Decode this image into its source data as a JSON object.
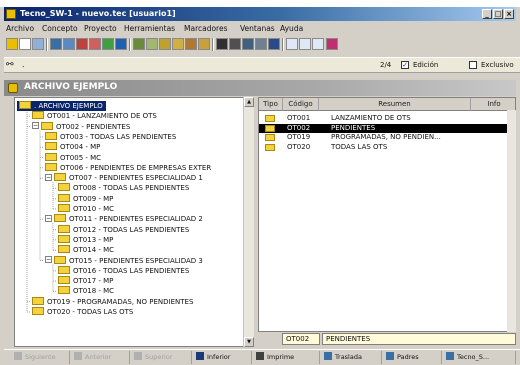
{
  "window": {
    "title": "Tecno_SW-1 - nuevo.tec  [usuario1]",
    "top_fringe_text": "..."
  },
  "menu": [
    "Archivo",
    "Concepto",
    "Proyecto",
    "Herramientas",
    "Marcadores",
    "Ventanas",
    "Ayuda"
  ],
  "nav": {
    "page_indicator": "2/4",
    "edit_checkbox_label": "Edición",
    "edit_checked": true,
    "exclusive_checkbox_label": "Exclusivo",
    "exclusive_checked": false
  },
  "header": {
    "title": "ARCHIVO EJEMPLO"
  },
  "tree": [
    {
      "label": ". ARCHIVO EJEMPLO",
      "level": 0,
      "selected": true
    },
    {
      "label": "OT001 - LANZAMIENTO DE OTS",
      "level": 1
    },
    {
      "label": "OT002 - PENDIENTES",
      "level": 1,
      "expanded": true
    },
    {
      "label": "OT003 - TODAS LAS PENDIENTES",
      "level": 2
    },
    {
      "label": "OT004 - MP",
      "level": 2
    },
    {
      "label": "OT005 - MC",
      "level": 2
    },
    {
      "label": "OT006 - PENDIENTES DE EMPRESAS EXTER",
      "level": 2
    },
    {
      "label": "OT007 - PENDIENTES ESPECIALIDAD 1",
      "level": 2,
      "expanded": true
    },
    {
      "label": "OT008 - TODAS LAS PENDIENTES",
      "level": 3
    },
    {
      "label": "OT009 - MP",
      "level": 3
    },
    {
      "label": "OT010 - MC",
      "level": 3
    },
    {
      "label": "OT011 - PENDIENTES ESPECIALIDAD 2",
      "level": 2,
      "expanded": true
    },
    {
      "label": "OT012 - TODAS LAS PENDIENTES",
      "level": 3
    },
    {
      "label": "OT013 - MP",
      "level": 3
    },
    {
      "label": "OT014 - MC",
      "level": 3
    },
    {
      "label": "OT015 - PENDIENTES ESPECIALIDAD 3",
      "level": 2,
      "expanded": true
    },
    {
      "label": "OT016 - TODAS LAS PENDIENTES",
      "level": 3
    },
    {
      "label": "OT017 - MP",
      "level": 3
    },
    {
      "label": "OT018 - MC",
      "level": 3
    },
    {
      "label": "OT019 - PROGRAMADAS, NO PENDIENTES",
      "level": 1
    },
    {
      "label": "OT020 - TODAS LAS OTS",
      "level": 1
    }
  ],
  "list": {
    "columns": [
      "Tipo",
      "Código",
      "Resumen",
      "Info"
    ],
    "rows": [
      {
        "code": "OT001",
        "summary": "LANZAMIENTO DE OTS",
        "selected": false
      },
      {
        "code": "OT002",
        "summary": "PENDIENTES",
        "selected": true
      },
      {
        "code": "OT019",
        "summary": "PROGRAMADAS, NO PENDIEN...",
        "selected": false
      },
      {
        "code": "OT020",
        "summary": "TODAS LAS OTS",
        "selected": false
      }
    ]
  },
  "edit": {
    "code": "OT002",
    "summary": "PENDIENTES"
  },
  "bottom": [
    {
      "label": "Siguiente",
      "disabled": true
    },
    {
      "label": "Anterior",
      "disabled": true
    },
    {
      "label": "Superior",
      "disabled": true
    },
    {
      "label": "Inferior",
      "disabled": false
    },
    {
      "label": "Imprime",
      "disabled": false
    },
    {
      "label": "Traslada",
      "disabled": false
    },
    {
      "label": "Padres",
      "disabled": false
    },
    {
      "label": "Tecno_S...",
      "disabled": false
    }
  ],
  "colors": {
    "selection": "#0a246a",
    "folder": "#f4d23c",
    "list_selection": "#000000"
  }
}
